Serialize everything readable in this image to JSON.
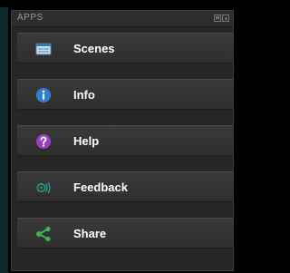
{
  "panel": {
    "title": "APPS"
  },
  "items": [
    {
      "label": "Scenes",
      "icon": "scenes-icon"
    },
    {
      "label": "Info",
      "icon": "info-icon"
    },
    {
      "label": "Help",
      "icon": "help-icon"
    },
    {
      "label": "Feedback",
      "icon": "feedback-icon"
    },
    {
      "label": "Share",
      "icon": "share-icon"
    }
  ],
  "colors": {
    "background": "#000000",
    "panel": "#262626",
    "item": "#353535",
    "info_blue": "#2f7fd6",
    "help_purple": "#9b3fc2",
    "feedback_teal": "#2c8f86",
    "share_green": "#3fb34a"
  }
}
